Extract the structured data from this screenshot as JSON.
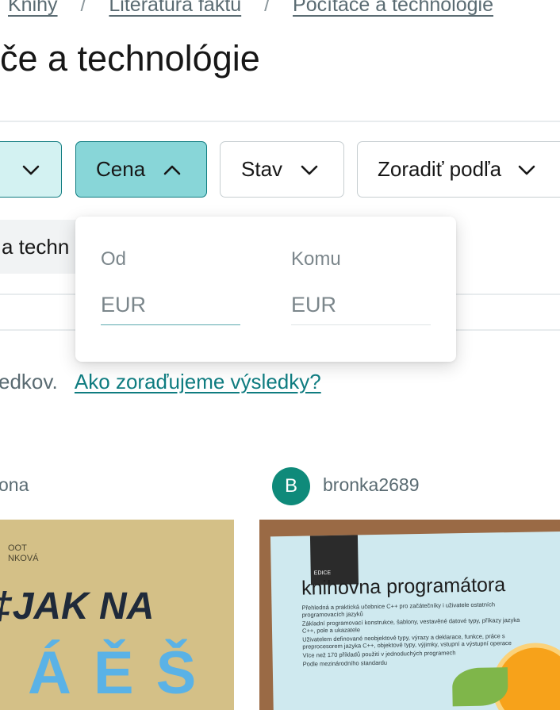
{
  "breadcrumb": {
    "items": [
      "Knihy",
      "Literatúra faktu",
      "Počítače a technológie"
    ],
    "separator": "/"
  },
  "page_title": "če a technológie",
  "filters": [
    {
      "label": "",
      "state": "collapsed"
    },
    {
      "label": "Cena",
      "state": "expanded"
    },
    {
      "label": "Stav",
      "state": "collapsed"
    },
    {
      "label": "Zoradiť podľa",
      "state": "collapsed"
    }
  ],
  "active_chip": "a techn",
  "price_dropdown": {
    "from_label": "Od",
    "from_placeholder": "EUR",
    "to_label": "Komu",
    "to_placeholder": "EUR"
  },
  "results": {
    "text": "edkov.",
    "link": "Ako zoraďujeme výsledky?"
  },
  "listings": [
    {
      "seller": "ona",
      "avatar_letter": "",
      "cover_text": [
        "OOT",
        "NKOVÁ",
        "‡JAK NA",
        "ÁĚŠ"
      ]
    },
    {
      "seller": "bronka2689",
      "avatar_letter": "B",
      "cover_title": "knihovna programátora",
      "cover_top": "EDICE",
      "cover_bullets": [
        "Přehledná a praktická učebnice C++ pro začátečníky i uživatele ostatních programovacích jazyků",
        "Základní programovací konstrukce, šablony, vestavěné datové typy, příkazy jazyka C++, pole a ukazatele",
        "Uživatelem definované neobjektové typy, výrazy a deklarace, funkce, práce s preprocesorem jazyka C++, objektové typy, výjimky, vstupní a výstupní operace",
        "Více než 170 příkladů použití v jednoduchých programech",
        "Podle mezinárodního standardu"
      ]
    }
  ],
  "colors": {
    "accent": "#0f7c80",
    "active_filter_bg": "#88d6d8",
    "first_filter_bg": "#d3f2f2",
    "avatar": "#0f8a7a",
    "link": "#0f7c80"
  }
}
